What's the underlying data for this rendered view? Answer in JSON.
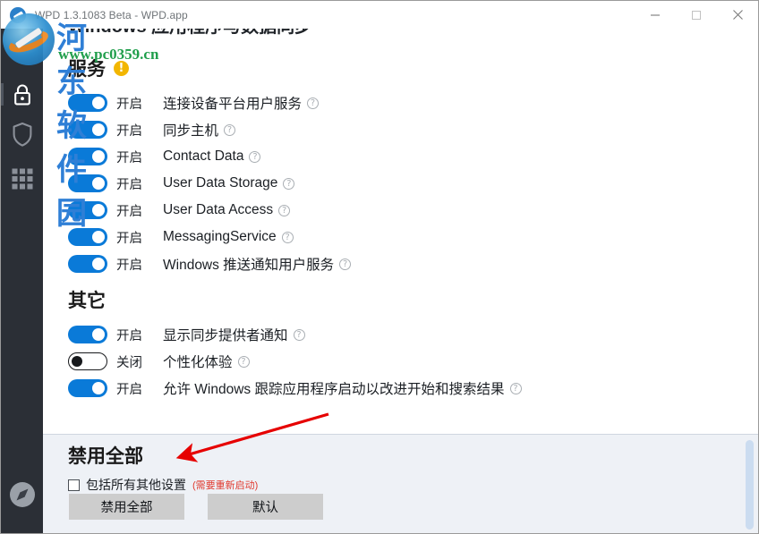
{
  "window": {
    "title": "WPD 1.3.1083 Beta - WPD.app",
    "minimize_label": "—",
    "maximize_label": "□",
    "close_label": "✕"
  },
  "rail": {
    "items": [
      {
        "name": "privacy",
        "icon": "lock-icon",
        "active": true
      },
      {
        "name": "firewall",
        "icon": "shield-icon",
        "active": false
      },
      {
        "name": "appx",
        "icon": "grid-icon",
        "active": false
      }
    ],
    "footer": {
      "name": "about",
      "icon": "compass-icon"
    }
  },
  "page": {
    "heading": "Windows 应用程序与数据同步"
  },
  "services_section": {
    "title": "服务",
    "warning_badge": "!",
    "items": [
      {
        "state": "开启",
        "on": true,
        "label": "连接设备平台用户服务",
        "help": "?"
      },
      {
        "state": "开启",
        "on": true,
        "label": "同步主机",
        "help": "?"
      },
      {
        "state": "开启",
        "on": true,
        "label": "Contact Data",
        "help": "?"
      },
      {
        "state": "开启",
        "on": true,
        "label": "User Data Storage",
        "help": "?"
      },
      {
        "state": "开启",
        "on": true,
        "label": "User Data Access",
        "help": "?"
      },
      {
        "state": "开启",
        "on": true,
        "label": "MessagingService",
        "help": "?"
      },
      {
        "state": "开启",
        "on": true,
        "label": "Windows 推送通知用户服务",
        "help": "?"
      }
    ]
  },
  "other_section": {
    "title": "其它",
    "items": [
      {
        "state": "开启",
        "on": true,
        "label": "显示同步提供者通知",
        "help": "?"
      },
      {
        "state": "关闭",
        "on": false,
        "label": "个性化体验",
        "help": "?"
      },
      {
        "state": "开启",
        "on": true,
        "label": "允许 Windows 跟踪应用程序启动以改进开始和搜索结果",
        "help": "?"
      }
    ]
  },
  "bottom_panel": {
    "title": "禁用全部",
    "checkbox_label": "包括所有其他设置",
    "checkbox_note": "(需要重新启动)",
    "checkbox_checked": false,
    "primary_button": "禁用全部",
    "secondary_button": "默认"
  },
  "watermark": {
    "site_cn": "河东软件园",
    "site_url": "www.pc0359.cn"
  },
  "colors": {
    "toggle_on": "#0a7ad8",
    "rail_bg": "#2b2f36",
    "panel_bg": "#eef1f6",
    "warning": "#f2b600",
    "note_red": "#e03a2f",
    "button_gray": "#cdcdcd",
    "accent_bar": "#cbdcf0"
  }
}
